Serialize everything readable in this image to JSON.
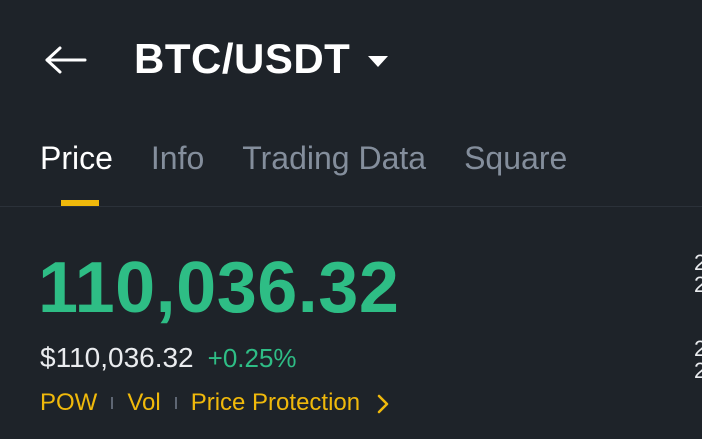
{
  "header": {
    "back_icon": "arrow-left-icon",
    "pair": "BTC/USDT",
    "dropdown_icon": "caret-down-icon"
  },
  "tabs": [
    {
      "label": "Price",
      "active": true
    },
    {
      "label": "Info",
      "active": false
    },
    {
      "label": "Trading Data",
      "active": false
    },
    {
      "label": "Square",
      "active": false
    }
  ],
  "price": {
    "last": "110,036.32",
    "fiat": "$110,036.32",
    "change": "+0.25%"
  },
  "tags": {
    "pow": "POW",
    "vol": "Vol",
    "price_protection": "Price Protection",
    "chevron_icon": "chevron-right-icon"
  },
  "colors": {
    "background": "#1E2329",
    "up": "#2EBD85",
    "accent": "#F0B90B",
    "muted": "#848E9C"
  }
}
